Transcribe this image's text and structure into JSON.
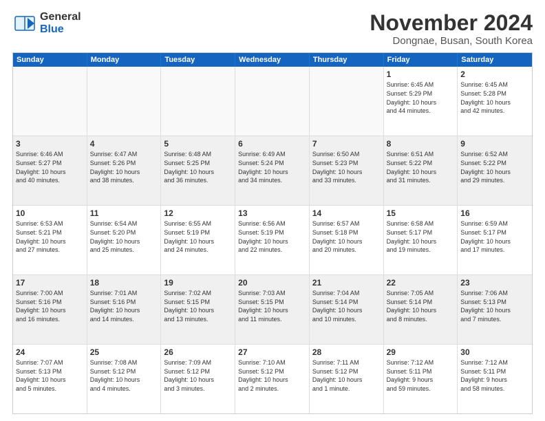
{
  "logo": {
    "general": "General",
    "blue": "Blue"
  },
  "header": {
    "month": "November 2024",
    "location": "Dongnae, Busan, South Korea"
  },
  "weekdays": [
    "Sunday",
    "Monday",
    "Tuesday",
    "Wednesday",
    "Thursday",
    "Friday",
    "Saturday"
  ],
  "rows": [
    [
      {
        "day": "",
        "info": "",
        "empty": true
      },
      {
        "day": "",
        "info": "",
        "empty": true
      },
      {
        "day": "",
        "info": "",
        "empty": true
      },
      {
        "day": "",
        "info": "",
        "empty": true
      },
      {
        "day": "",
        "info": "",
        "empty": true
      },
      {
        "day": "1",
        "info": "Sunrise: 6:45 AM\nSunset: 5:29 PM\nDaylight: 10 hours\nand 44 minutes.",
        "empty": false
      },
      {
        "day": "2",
        "info": "Sunrise: 6:45 AM\nSunset: 5:28 PM\nDaylight: 10 hours\nand 42 minutes.",
        "empty": false
      }
    ],
    [
      {
        "day": "3",
        "info": "Sunrise: 6:46 AM\nSunset: 5:27 PM\nDaylight: 10 hours\nand 40 minutes.",
        "empty": false
      },
      {
        "day": "4",
        "info": "Sunrise: 6:47 AM\nSunset: 5:26 PM\nDaylight: 10 hours\nand 38 minutes.",
        "empty": false
      },
      {
        "day": "5",
        "info": "Sunrise: 6:48 AM\nSunset: 5:25 PM\nDaylight: 10 hours\nand 36 minutes.",
        "empty": false
      },
      {
        "day": "6",
        "info": "Sunrise: 6:49 AM\nSunset: 5:24 PM\nDaylight: 10 hours\nand 34 minutes.",
        "empty": false
      },
      {
        "day": "7",
        "info": "Sunrise: 6:50 AM\nSunset: 5:23 PM\nDaylight: 10 hours\nand 33 minutes.",
        "empty": false
      },
      {
        "day": "8",
        "info": "Sunrise: 6:51 AM\nSunset: 5:22 PM\nDaylight: 10 hours\nand 31 minutes.",
        "empty": false
      },
      {
        "day": "9",
        "info": "Sunrise: 6:52 AM\nSunset: 5:22 PM\nDaylight: 10 hours\nand 29 minutes.",
        "empty": false
      }
    ],
    [
      {
        "day": "10",
        "info": "Sunrise: 6:53 AM\nSunset: 5:21 PM\nDaylight: 10 hours\nand 27 minutes.",
        "empty": false
      },
      {
        "day": "11",
        "info": "Sunrise: 6:54 AM\nSunset: 5:20 PM\nDaylight: 10 hours\nand 25 minutes.",
        "empty": false
      },
      {
        "day": "12",
        "info": "Sunrise: 6:55 AM\nSunset: 5:19 PM\nDaylight: 10 hours\nand 24 minutes.",
        "empty": false
      },
      {
        "day": "13",
        "info": "Sunrise: 6:56 AM\nSunset: 5:19 PM\nDaylight: 10 hours\nand 22 minutes.",
        "empty": false
      },
      {
        "day": "14",
        "info": "Sunrise: 6:57 AM\nSunset: 5:18 PM\nDaylight: 10 hours\nand 20 minutes.",
        "empty": false
      },
      {
        "day": "15",
        "info": "Sunrise: 6:58 AM\nSunset: 5:17 PM\nDaylight: 10 hours\nand 19 minutes.",
        "empty": false
      },
      {
        "day": "16",
        "info": "Sunrise: 6:59 AM\nSunset: 5:17 PM\nDaylight: 10 hours\nand 17 minutes.",
        "empty": false
      }
    ],
    [
      {
        "day": "17",
        "info": "Sunrise: 7:00 AM\nSunset: 5:16 PM\nDaylight: 10 hours\nand 16 minutes.",
        "empty": false
      },
      {
        "day": "18",
        "info": "Sunrise: 7:01 AM\nSunset: 5:16 PM\nDaylight: 10 hours\nand 14 minutes.",
        "empty": false
      },
      {
        "day": "19",
        "info": "Sunrise: 7:02 AM\nSunset: 5:15 PM\nDaylight: 10 hours\nand 13 minutes.",
        "empty": false
      },
      {
        "day": "20",
        "info": "Sunrise: 7:03 AM\nSunset: 5:15 PM\nDaylight: 10 hours\nand 11 minutes.",
        "empty": false
      },
      {
        "day": "21",
        "info": "Sunrise: 7:04 AM\nSunset: 5:14 PM\nDaylight: 10 hours\nand 10 minutes.",
        "empty": false
      },
      {
        "day": "22",
        "info": "Sunrise: 7:05 AM\nSunset: 5:14 PM\nDaylight: 10 hours\nand 8 minutes.",
        "empty": false
      },
      {
        "day": "23",
        "info": "Sunrise: 7:06 AM\nSunset: 5:13 PM\nDaylight: 10 hours\nand 7 minutes.",
        "empty": false
      }
    ],
    [
      {
        "day": "24",
        "info": "Sunrise: 7:07 AM\nSunset: 5:13 PM\nDaylight: 10 hours\nand 5 minutes.",
        "empty": false
      },
      {
        "day": "25",
        "info": "Sunrise: 7:08 AM\nSunset: 5:12 PM\nDaylight: 10 hours\nand 4 minutes.",
        "empty": false
      },
      {
        "day": "26",
        "info": "Sunrise: 7:09 AM\nSunset: 5:12 PM\nDaylight: 10 hours\nand 3 minutes.",
        "empty": false
      },
      {
        "day": "27",
        "info": "Sunrise: 7:10 AM\nSunset: 5:12 PM\nDaylight: 10 hours\nand 2 minutes.",
        "empty": false
      },
      {
        "day": "28",
        "info": "Sunrise: 7:11 AM\nSunset: 5:12 PM\nDaylight: 10 hours\nand 1 minute.",
        "empty": false
      },
      {
        "day": "29",
        "info": "Sunrise: 7:12 AM\nSunset: 5:11 PM\nDaylight: 9 hours\nand 59 minutes.",
        "empty": false
      },
      {
        "day": "30",
        "info": "Sunrise: 7:12 AM\nSunset: 5:11 PM\nDaylight: 9 hours\nand 58 minutes.",
        "empty": false
      }
    ]
  ]
}
